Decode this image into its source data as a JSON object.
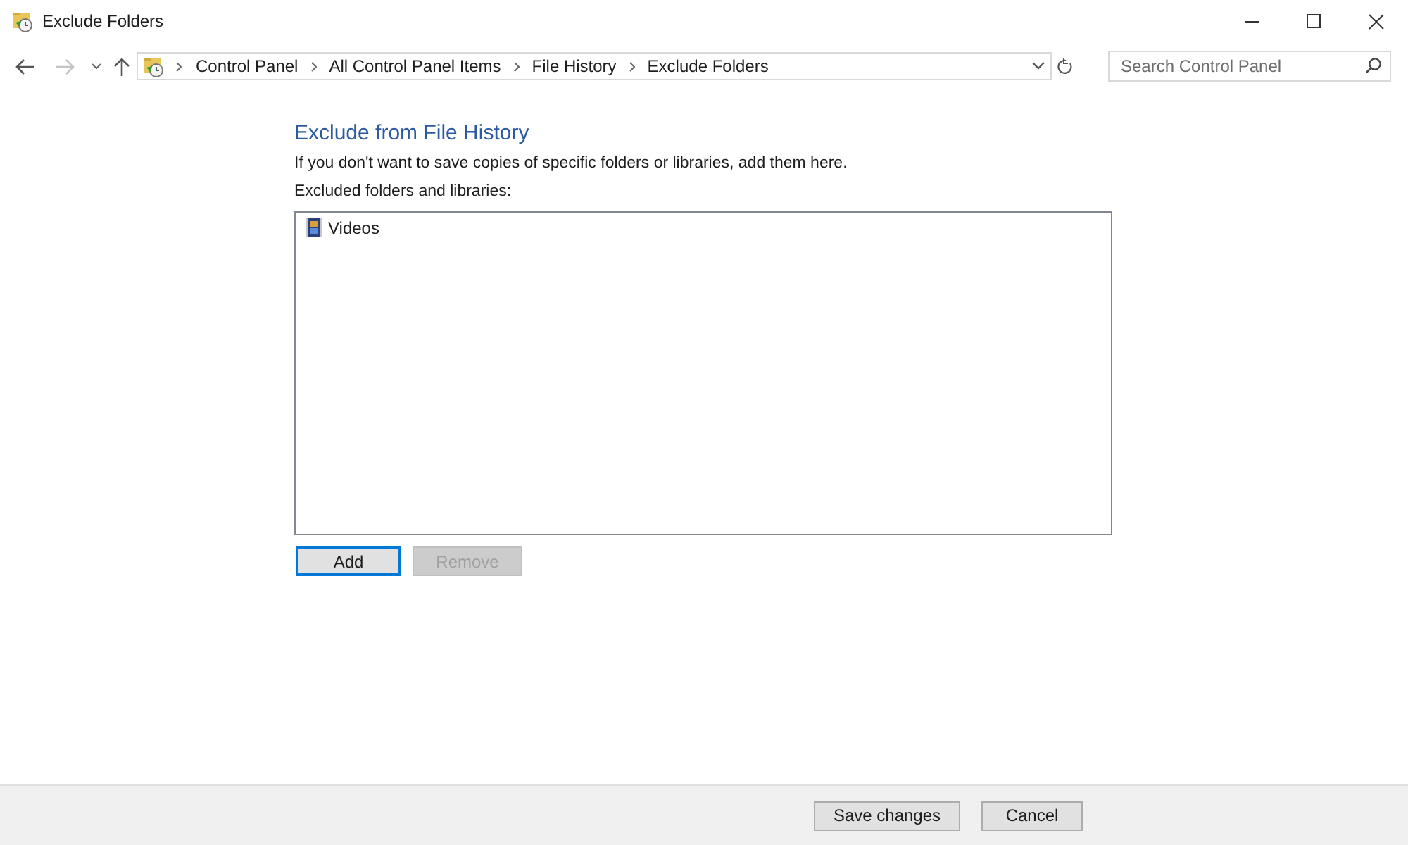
{
  "window": {
    "title": "Exclude Folders"
  },
  "navigation": {
    "back_disabled": false,
    "forward_disabled": true,
    "breadcrumb": [
      "Control Panel",
      "All Control Panel Items",
      "File History",
      "Exclude Folders"
    ],
    "search": {
      "placeholder": "Search Control Panel"
    }
  },
  "content": {
    "heading": "Exclude from File History",
    "description": "If you don't want to save copies of specific folders or libraries, add them here.",
    "list_label": "Excluded folders and libraries:",
    "excluded_items": [
      {
        "label": "Videos",
        "selected": false
      }
    ],
    "buttons": [
      {
        "label": "Add",
        "disabled": false,
        "focused": true
      },
      {
        "label": "Remove",
        "disabled": true,
        "focused": false
      }
    ]
  },
  "footer": {
    "buttons": [
      {
        "label": "Save changes",
        "disabled": false
      },
      {
        "label": "Cancel",
        "disabled": false
      }
    ]
  }
}
